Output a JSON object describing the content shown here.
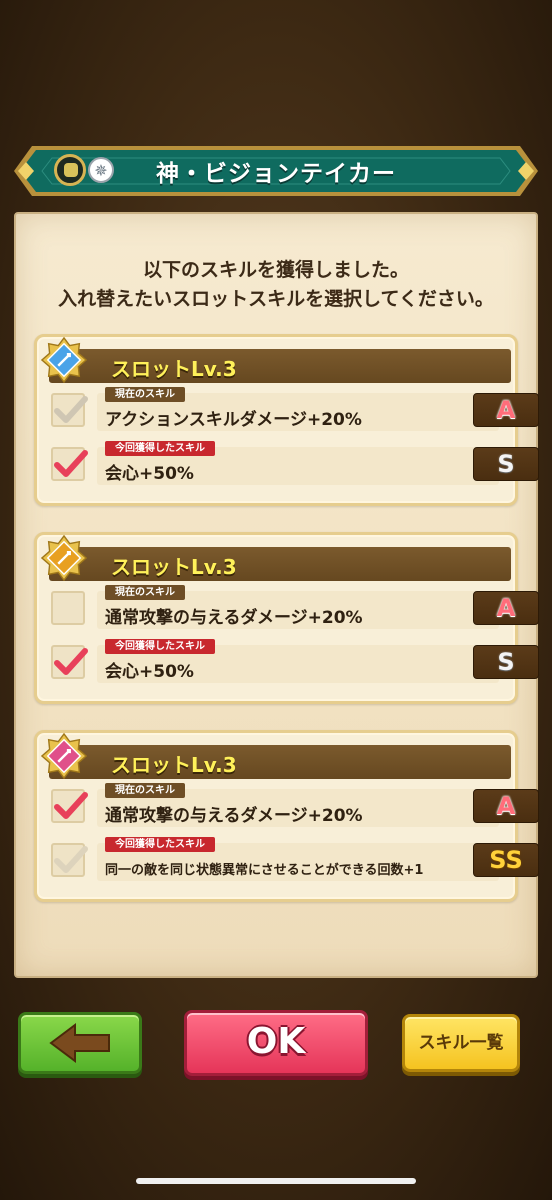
{
  "title": "神・ビジョンテイカー",
  "intro": {
    "line1": "以下のスキルを獲得しました。",
    "line2": "入れ替えたいスロットスキルを選択してください。"
  },
  "slots": [
    {
      "title": "スロットLv.3",
      "emblem_color": "#4aa3e8",
      "current": {
        "tag": "現在のスキル",
        "text": "アクションスキルダメージ+20%",
        "rank": "A",
        "checked": true,
        "dimmed": true
      },
      "new": {
        "tag": "今回獲得したスキル",
        "text": "会心+50%",
        "rank": "S",
        "checked": true,
        "dimmed": false
      }
    },
    {
      "title": "スロットLv.3",
      "emblem_color": "#e8a020",
      "current": {
        "tag": "現在のスキル",
        "text": "通常攻撃の与えるダメージ+20%",
        "rank": "A",
        "checked": false,
        "dimmed": false
      },
      "new": {
        "tag": "今回獲得したスキル",
        "text": "会心+50%",
        "rank": "S",
        "checked": true,
        "dimmed": false
      }
    },
    {
      "title": "スロットLv.3",
      "emblem_color": "#e0508a",
      "current": {
        "tag": "現在のスキル",
        "text": "通常攻撃の与えるダメージ+20%",
        "rank": "A",
        "checked": true,
        "dimmed": false
      },
      "new": {
        "tag": "今回獲得したスキル",
        "text": "同一の敵を同じ状態異常にさせることができる回数+1",
        "rank": "SS",
        "checked": true,
        "dimmed": true
      }
    }
  ],
  "buttons": {
    "ok": "OK",
    "skill_list": "スキル一覧"
  },
  "colors": {
    "banner": "#0f6b5f",
    "check_active": "#e8405a",
    "check_dim": "#d6cbb2"
  }
}
